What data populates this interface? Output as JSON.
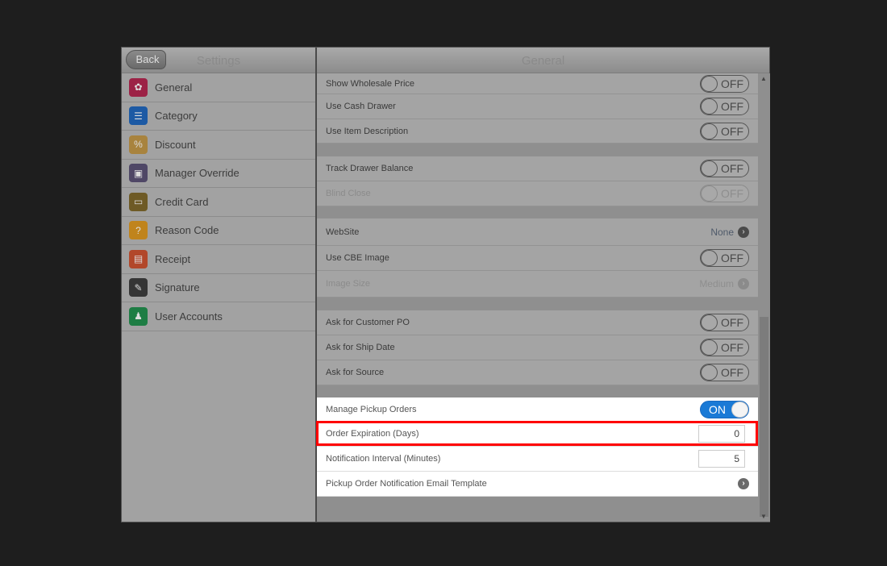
{
  "header": {
    "back_label": "Back",
    "left_title": "Settings",
    "right_title": "General"
  },
  "sidebar": {
    "items": [
      {
        "label": "General",
        "icon": "gear-icon",
        "color": "#9c2246",
        "glyph": "✿"
      },
      {
        "label": "Category",
        "icon": "list-icon",
        "color": "#1d5aa4",
        "glyph": "☰"
      },
      {
        "label": "Discount",
        "icon": "tag-icon",
        "color": "#a8833e",
        "glyph": "%"
      },
      {
        "label": "Manager Override",
        "icon": "id-card-icon",
        "color": "#4f4766",
        "glyph": "▣"
      },
      {
        "label": "Credit Card",
        "icon": "credit-card-icon",
        "color": "#6e5a25",
        "glyph": "▭"
      },
      {
        "label": "Reason Code",
        "icon": "question-icon",
        "color": "#c0841c",
        "glyph": "?"
      },
      {
        "label": "Receipt",
        "icon": "receipt-icon",
        "color": "#b2472a",
        "glyph": "▤"
      },
      {
        "label": "Signature",
        "icon": "pen-icon",
        "color": "#353535",
        "glyph": "✎"
      },
      {
        "label": "User Accounts",
        "icon": "user-icon",
        "color": "#1e7d44",
        "glyph": "♟"
      }
    ]
  },
  "settings": [
    {
      "label": "Show Wholesale Price",
      "type": "toggle",
      "value": "OFF"
    },
    {
      "label": "Use Cash Drawer",
      "type": "toggle",
      "value": "OFF"
    },
    {
      "label": "Use Item Description",
      "type": "toggle",
      "value": "OFF"
    },
    {
      "label": "Track Drawer Balance",
      "type": "toggle",
      "value": "OFF"
    },
    {
      "label": "Blind Close",
      "type": "toggle",
      "value": "OFF",
      "disabled": true
    },
    {
      "label": "WebSite",
      "type": "nav",
      "value": "None"
    },
    {
      "label": "Use CBE Image",
      "type": "toggle",
      "value": "OFF"
    },
    {
      "label": "Image Size",
      "type": "nav",
      "value": "Medium",
      "disabled": true
    },
    {
      "label": "Ask for Customer PO",
      "type": "toggle",
      "value": "OFF"
    },
    {
      "label": "Ask for Ship Date",
      "type": "toggle",
      "value": "OFF"
    },
    {
      "label": "Ask for Source",
      "type": "toggle",
      "value": "OFF"
    },
    {
      "label": "Manage Pickup Orders",
      "type": "toggle",
      "value": "ON",
      "white": true
    },
    {
      "label": "Order Expiration (Days)",
      "type": "number",
      "value": "0",
      "white": true
    },
    {
      "label": "Notification Interval (Minutes)",
      "type": "number",
      "value": "5",
      "white": true
    },
    {
      "label": "Pickup Order Notification Email Template",
      "type": "nav",
      "value": "",
      "white": true
    }
  ],
  "colors": {
    "highlight": "#ff0000",
    "toggle_on": "#1a7ad6"
  }
}
